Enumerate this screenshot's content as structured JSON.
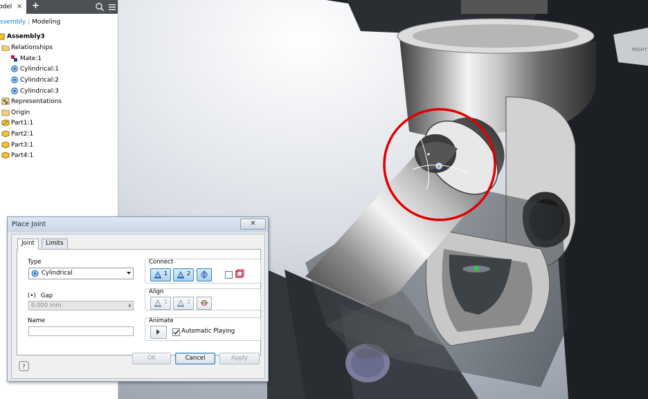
{
  "browser": {
    "tab_label": "odel",
    "close_glyph": "×",
    "add_glyph": "+",
    "mode_active": "ssembly",
    "mode_other": "Modeling",
    "root": "Assembly3",
    "items": [
      {
        "label": "Relationships",
        "icon": "folder-open-icon"
      },
      {
        "label": "Mate:1",
        "icon": "mate-constraint-icon"
      },
      {
        "label": "Cylindrical:1",
        "icon": "cylindrical-joint-icon"
      },
      {
        "label": "Cylindrical:2",
        "icon": "cylindrical-joint-icon"
      },
      {
        "label": "Cylindrical:3",
        "icon": "cylindrical-joint-icon"
      },
      {
        "label": "Representations",
        "icon": "representations-icon"
      },
      {
        "label": "Origin",
        "icon": "folder-icon"
      },
      {
        "label": "Part1:1",
        "icon": "part-grounded-icon"
      },
      {
        "label": "Part2:1",
        "icon": "part-icon"
      },
      {
        "label": "Part3:1",
        "icon": "part-icon"
      },
      {
        "label": "Part4:1",
        "icon": "part-icon"
      }
    ]
  },
  "viewport": {
    "viewcube_label": "RIGHT"
  },
  "dialog": {
    "title": "Place Joint",
    "close_glyph": "✕",
    "tabs": [
      "Joint",
      "Limits"
    ],
    "type_label": "Type",
    "type_value": "Cylindrical",
    "gap_label": "Gap",
    "gap_value": "0.000 mm",
    "name_label": "Name",
    "name_value": "",
    "connect_label": "Connect",
    "connect_btn1": "1",
    "connect_btn2": "2",
    "align_label": "Align",
    "align_btn1": "1",
    "align_btn2": "2",
    "animate_label": "Animate",
    "automatic_playing_label": "Automatic Playing",
    "automatic_playing_checked": true,
    "ok_label": "OK",
    "cancel_label": "Cancel",
    "apply_label": "Apply"
  },
  "colors": {
    "highlight_circle": "#e00000",
    "accent_blue": "#1e7bd3"
  }
}
